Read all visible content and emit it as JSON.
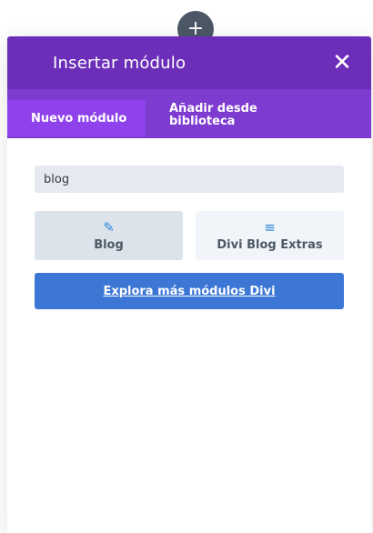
{
  "add_handle": {
    "icon": "plus-icon",
    "glyph": "+"
  },
  "modal": {
    "title": "Insertar módulo",
    "close_glyph": "✕",
    "colors": {
      "header": "#6c2eb9",
      "tabs": "#7e3bd0",
      "active_tab": "#8f42ec",
      "button": "#3d77d6"
    }
  },
  "tabs": [
    {
      "label": "Nuevo módulo",
      "active": true
    },
    {
      "label": "Añadir desde biblioteca",
      "active": false
    }
  ],
  "search": {
    "value": "blog",
    "placeholder": ""
  },
  "modules": [
    {
      "label": "Blog",
      "icon": "edit-icon",
      "glyph": "✎"
    },
    {
      "label": "Divi Blog Extras",
      "icon": "list-icon",
      "glyph": "≡"
    }
  ],
  "explore_button": {
    "label": "Explora más módulos Divi"
  }
}
